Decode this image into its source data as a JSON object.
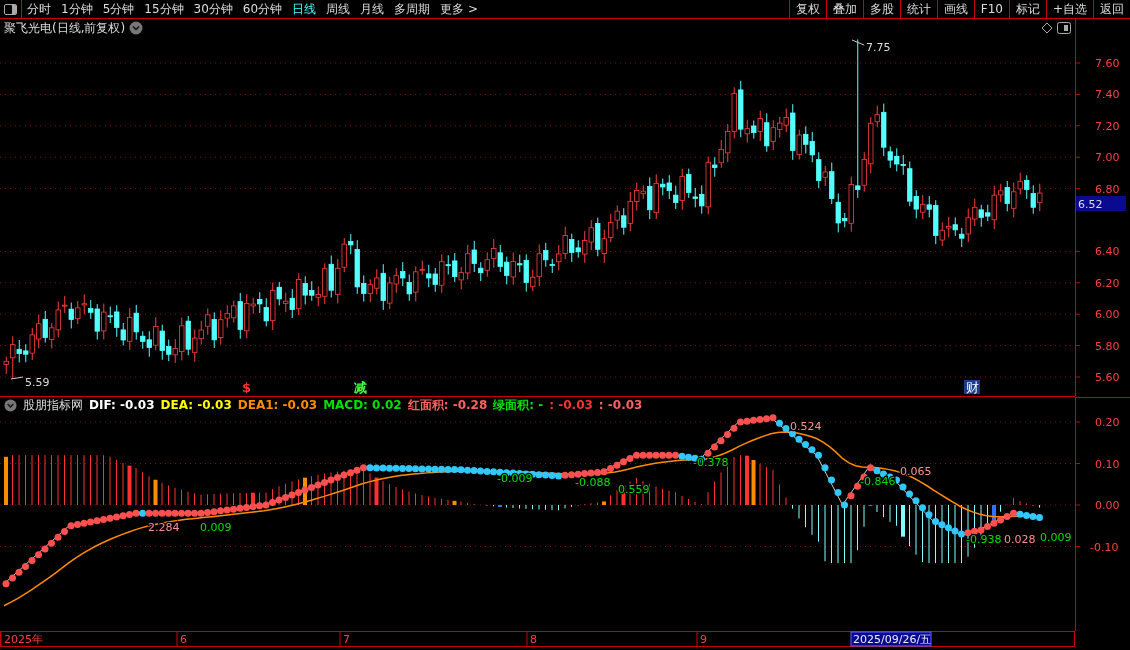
{
  "toolbar": {
    "periods": [
      {
        "label": "分时",
        "selected": false
      },
      {
        "label": "1分钟",
        "selected": false
      },
      {
        "label": "5分钟",
        "selected": false
      },
      {
        "label": "15分钟",
        "selected": false
      },
      {
        "label": "30分钟",
        "selected": false
      },
      {
        "label": "60分钟",
        "selected": false
      },
      {
        "label": "日线",
        "selected": true
      },
      {
        "label": "周线",
        "selected": false
      },
      {
        "label": "月线",
        "selected": false
      },
      {
        "label": "多周期",
        "selected": false
      },
      {
        "label": "更多 >",
        "selected": false
      }
    ],
    "actions": [
      "复权",
      "叠加",
      "多股",
      "统计",
      "画线",
      "F10",
      "标记",
      "+自选",
      "返回"
    ]
  },
  "chart_title": "聚飞光电(日线,前复权)",
  "price_axis": {
    "ticks": [
      "7.60",
      "7.40",
      "7.20",
      "7.00",
      "6.80",
      "6.40",
      "6.20",
      "6.00",
      "5.80",
      "5.60"
    ],
    "current": "6.52"
  },
  "price_annotations": [
    {
      "kind": "high",
      "text": "7.75"
    },
    {
      "kind": "low",
      "text": "5.59"
    }
  ],
  "event_markers": [
    {
      "kind": "plain",
      "text": "$",
      "color": "#ff3030"
    },
    {
      "kind": "plain",
      "text": "减",
      "color": "#40ff40"
    },
    {
      "kind": "boxed",
      "text": "财",
      "color": "#1a3c8c"
    }
  ],
  "indicator": {
    "name": "股朋指标网",
    "values": [
      {
        "text": "DIF: -0.03",
        "color": "#ffffff"
      },
      {
        "text": "DEA: -0.03",
        "color": "#ffff00"
      },
      {
        "text": "DEA1: -0.03",
        "color": "#ff8c00"
      },
      {
        "text": "MACD: 0.02",
        "color": "#00e000"
      },
      {
        "text": "红面积: -0.28",
        "color": "#ff6060"
      },
      {
        "text": "绿面积: -",
        "color": "#00e000"
      },
      {
        "text": ": -0.03",
        "color": "#ff3030"
      },
      {
        "text": ": -0.03",
        "color": "#ff6060"
      }
    ]
  },
  "indicator_axis": {
    "ticks": [
      "0.20",
      "0.10",
      "0.00",
      "-0.10"
    ]
  },
  "indicator_annotations": [
    {
      "text": "2.284",
      "color": "#ff9090"
    },
    {
      "text": "0.009",
      "color": "#00e000"
    },
    {
      "text": "-0.009",
      "color": "#00e000"
    },
    {
      "text": "-0.088",
      "color": "#00e000"
    },
    {
      "text": "0.559",
      "color": "#00e000"
    },
    {
      "text": "-0.378",
      "color": "#00e000"
    },
    {
      "text": "0.524",
      "color": "#ff9090"
    },
    {
      "text": "-0.846",
      "color": "#00e000"
    },
    {
      "text": "0.065",
      "color": "#ff9090"
    },
    {
      "text": "-0.938",
      "color": "#00e000"
    },
    {
      "text": "0.028",
      "color": "#ff9090"
    },
    {
      "text": "0.009",
      "color": "#00e000"
    }
  ],
  "date_axis": {
    "labels": [
      "2025年",
      "6",
      "7",
      "8",
      "9"
    ],
    "cursor": "2025/09/26/五"
  }
}
